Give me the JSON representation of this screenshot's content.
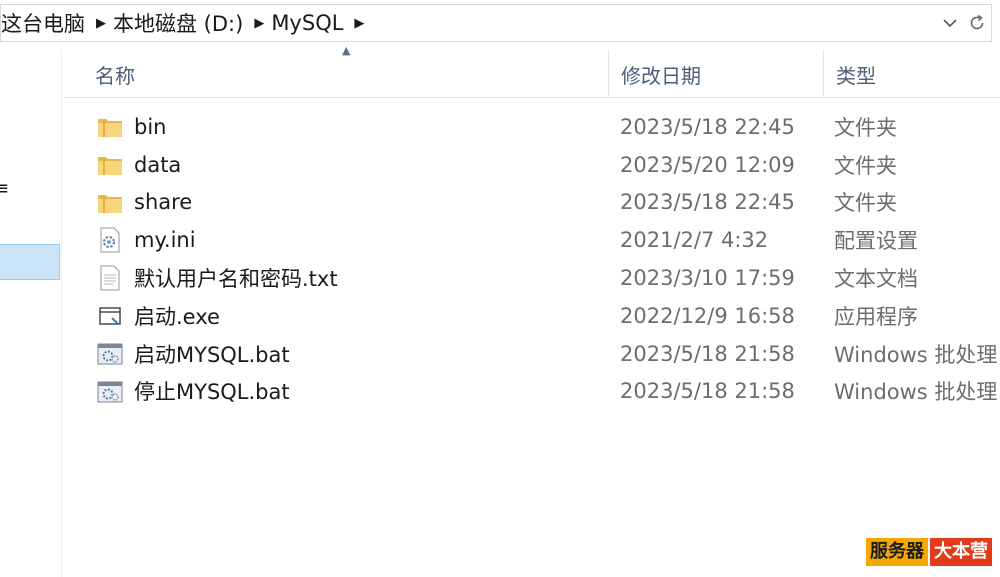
{
  "address_bar": {
    "crumbs": [
      "这台电脑",
      "本地磁盘 (D:)",
      "MySQL"
    ]
  },
  "nav_pane": {
    "fragment_text": "≡"
  },
  "columns": {
    "name": "名称",
    "date": "修改日期",
    "type": "类型"
  },
  "files": [
    {
      "name": "bin",
      "date": "2023/5/18 22:45",
      "type": "文件夹",
      "icon": "folder-icon"
    },
    {
      "name": "data",
      "date": "2023/5/20 12:09",
      "type": "文件夹",
      "icon": "folder-icon"
    },
    {
      "name": "share",
      "date": "2023/5/18 22:45",
      "type": "文件夹",
      "icon": "folder-icon"
    },
    {
      "name": "my.ini",
      "date": "2021/2/7 4:32",
      "type": "配置设置",
      "icon": "config-file-icon"
    },
    {
      "name": "默认用户名和密码.txt",
      "date": "2023/3/10 17:59",
      "type": "文本文档",
      "icon": "text-file-icon"
    },
    {
      "name": "启动.exe",
      "date": "2022/12/9 16:58",
      "type": "应用程序",
      "icon": "exe-file-icon"
    },
    {
      "name": "启动MYSQL.bat",
      "date": "2023/5/18 21:58",
      "type": "Windows 批处理",
      "icon": "batch-file-icon"
    },
    {
      "name": "停止MYSQL.bat",
      "date": "2023/5/18 21:58",
      "type": "Windows 批处理",
      "icon": "batch-file-icon"
    }
  ],
  "watermark": {
    "part1": "服务器",
    "part2": "大本营"
  }
}
